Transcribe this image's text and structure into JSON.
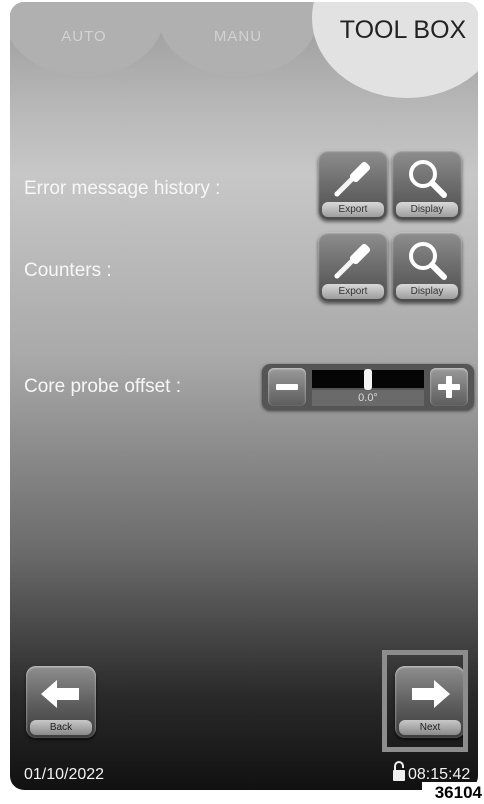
{
  "tabs": [
    {
      "label": "AUTO"
    },
    {
      "label": "MANU"
    },
    {
      "label": "TOOL BOX"
    }
  ],
  "rows": [
    {
      "label": "Error message history :",
      "export_label": "Export",
      "display_label": "Display"
    },
    {
      "label": "Counters :",
      "export_label": "Export",
      "display_label": "Display"
    }
  ],
  "core_probe": {
    "label": "Core probe offset :",
    "value": "0.0°"
  },
  "nav": {
    "back_label": "Back",
    "next_label": "Next"
  },
  "footer": {
    "date": "01/10/2022",
    "time": "08:15:42"
  },
  "reference": "36104",
  "icons": {
    "export": "pipette-icon",
    "display": "magnifier-icon",
    "minus": "minus-icon",
    "plus": "plus-icon",
    "back": "arrow-left-icon",
    "next": "arrow-right-icon",
    "lock": "padlock-icon"
  },
  "colors": {
    "highlight": "#8d8d8d",
    "label_text": "#f7f7f7"
  }
}
